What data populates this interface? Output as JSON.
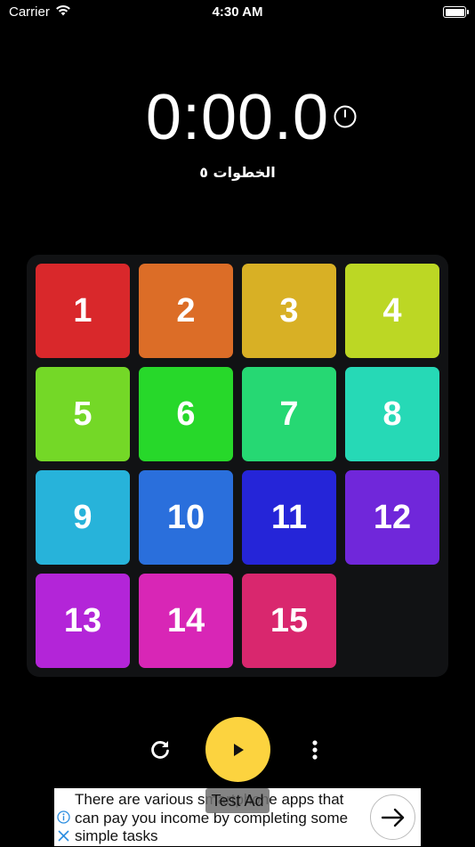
{
  "status_bar": {
    "carrier": "Carrier",
    "time": "4:30 AM",
    "wifi_icon": "wifi-icon",
    "battery_icon": "battery-icon"
  },
  "timer": {
    "value": "0:00.0",
    "icon": "timer-icon"
  },
  "moves": {
    "label": "الخطوات ٥"
  },
  "board": {
    "tiles": [
      {
        "label": "1",
        "color": "#d9282b"
      },
      {
        "label": "2",
        "color": "#dc6d27"
      },
      {
        "label": "3",
        "color": "#d8b025"
      },
      {
        "label": "4",
        "color": "#bcd724"
      },
      {
        "label": "5",
        "color": "#74d827"
      },
      {
        "label": "6",
        "color": "#27d82a"
      },
      {
        "label": "7",
        "color": "#26d873"
      },
      {
        "label": "8",
        "color": "#26d9b6"
      },
      {
        "label": "9",
        "color": "#27b3da"
      },
      {
        "label": "10",
        "color": "#2a6fdc"
      },
      {
        "label": "11",
        "color": "#2525d8"
      },
      {
        "label": "12",
        "color": "#7027da"
      },
      {
        "label": "13",
        "color": "#b325d8"
      },
      {
        "label": "14",
        "color": "#d826b6"
      },
      {
        "label": "15",
        "color": "#d9276e"
      }
    ],
    "background": "#111214"
  },
  "controls": {
    "refresh_icon": "refresh-icon",
    "play_icon": "play-icon",
    "more_icon": "more-vertical-icon",
    "play_color": "#fcd33f"
  },
  "ad": {
    "text": "There are various smartphone apps that can pay you income by completing some simple tasks",
    "label": "Test Ad",
    "info_icon": "info-icon",
    "close_icon": "close-icon",
    "arrow_icon": "arrow-right-icon"
  }
}
